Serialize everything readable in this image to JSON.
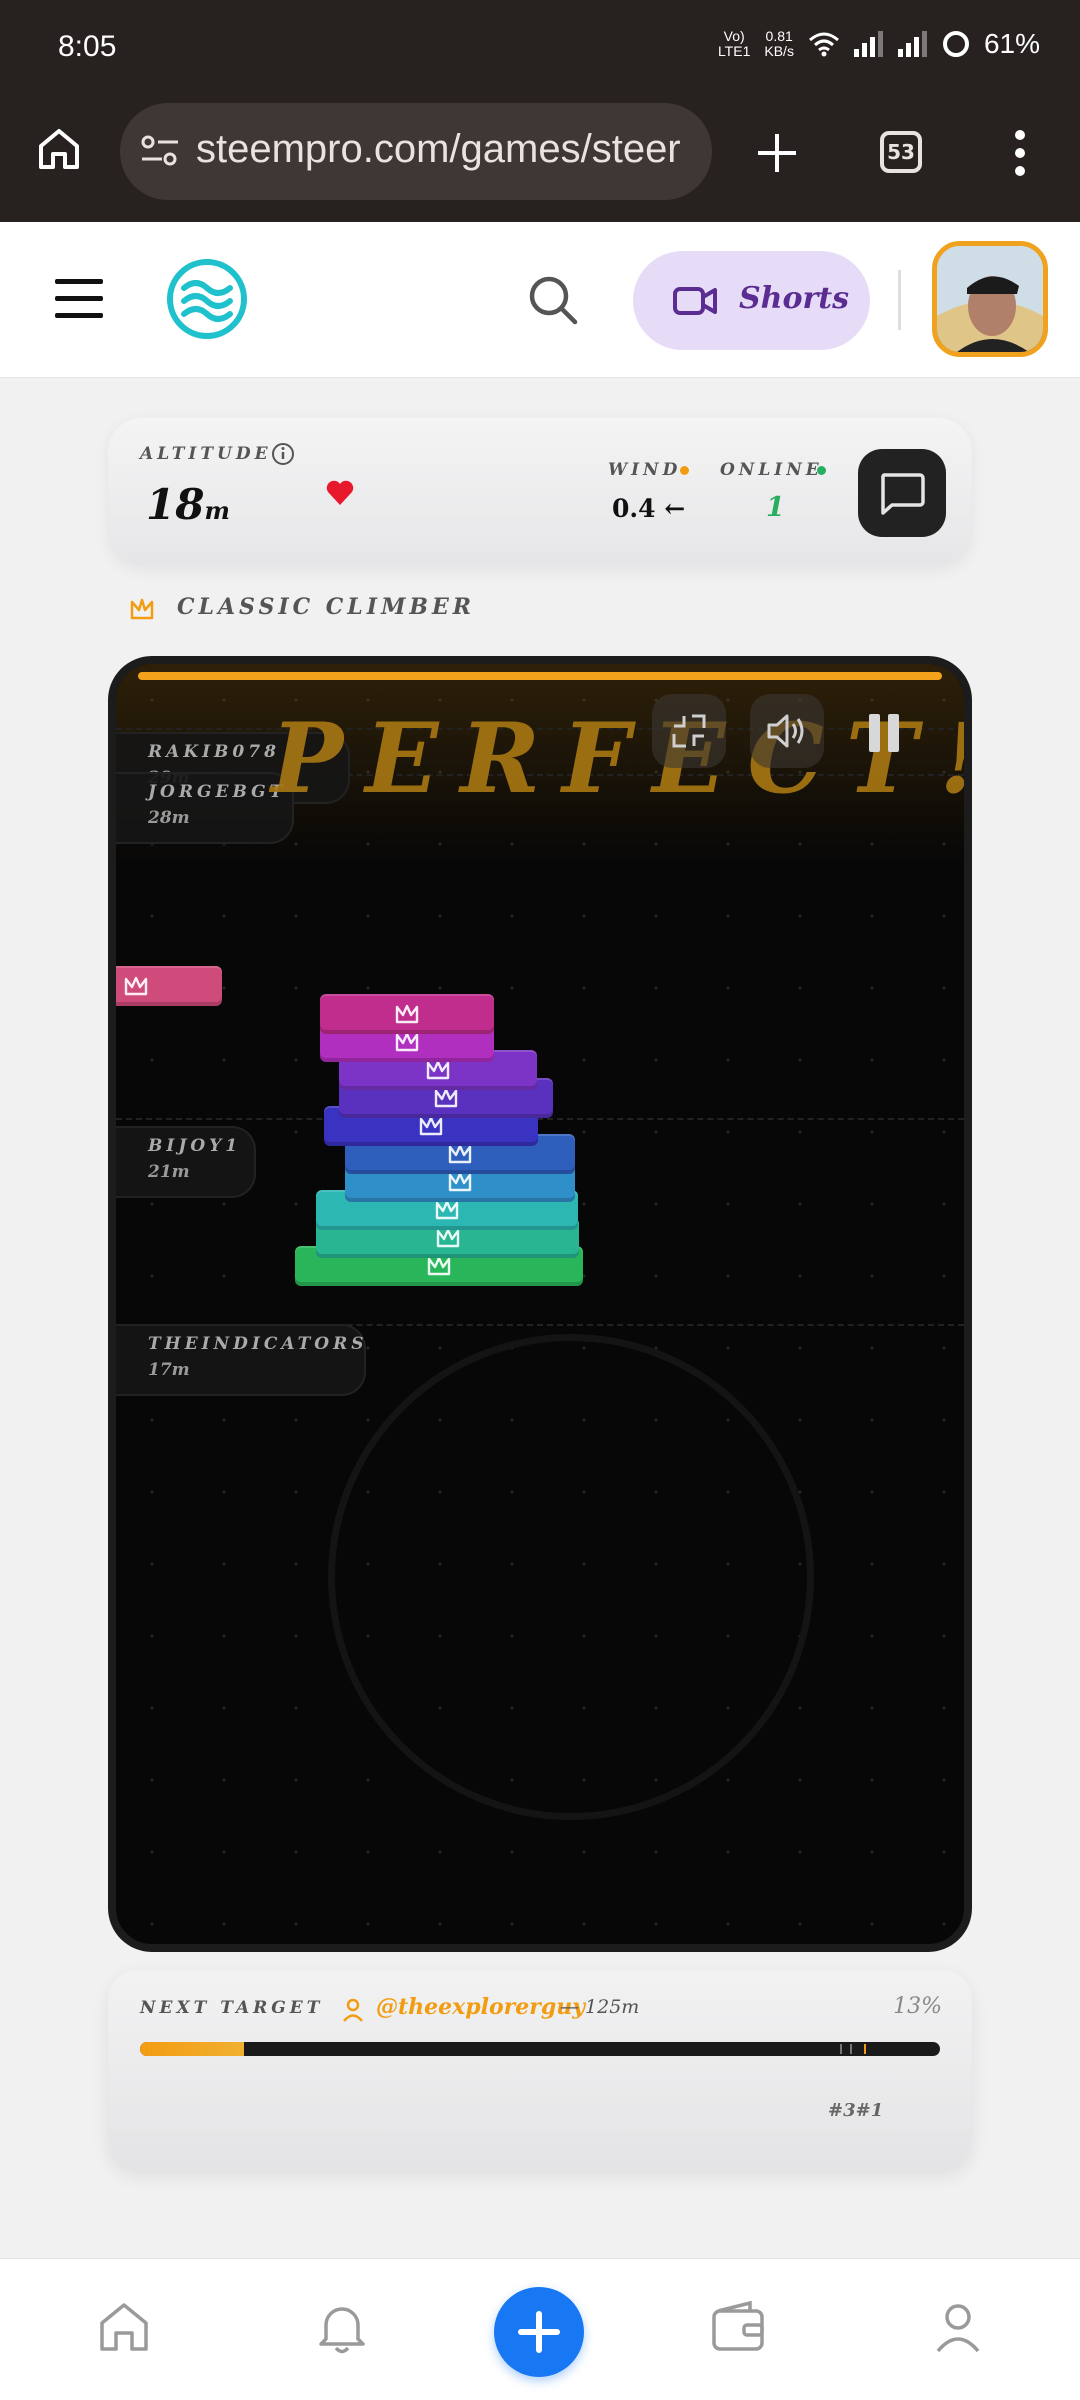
{
  "status_bar": {
    "time": "8:05",
    "network_top": "Vo)",
    "network_bottom": "LTE1",
    "speed_top": "0.81",
    "speed_bottom": "KB/s",
    "battery": "61%"
  },
  "browser": {
    "url": "steempro.com/games/steer",
    "tab_count": "53"
  },
  "header": {
    "shorts_label": "Shorts"
  },
  "stats": {
    "altitude_label": "ALTITUDE",
    "altitude_value": "18",
    "altitude_unit": "m",
    "wind_label": "WIND",
    "wind_value": "0.4 ←",
    "online_label": "ONLINE",
    "online_value": "1"
  },
  "mode": {
    "label": "CLASSIC CLIMBER"
  },
  "game": {
    "banner": "PERFECT!",
    "markers": [
      {
        "name": "RAKIB078",
        "height": "29m"
      },
      {
        "name": "JORGEBGT",
        "height": "28m"
      },
      {
        "name": "BIJOY1",
        "height": "21m"
      },
      {
        "name": "THEINDICATORS",
        "height": "17m"
      }
    ],
    "block_colors": [
      "#29b65a",
      "#27b592",
      "#2cb7b2",
      "#2f8fc9",
      "#2e5fbd",
      "#3a32c0",
      "#5a31bf",
      "#7b34c6",
      "#b12fbf",
      "#c02d8d",
      "#cf4b7c"
    ]
  },
  "next_target": {
    "label": "NEXT TARGET",
    "user": "@theexplorerguy",
    "distance": "— 125m",
    "progress_pct": "13%",
    "progress": 0.13,
    "rank": "#3#1"
  },
  "colors": {
    "accent": "#f39c12",
    "online_green": "#27ae60",
    "heart_red": "#e8192c",
    "fab_blue": "#1877f2"
  }
}
